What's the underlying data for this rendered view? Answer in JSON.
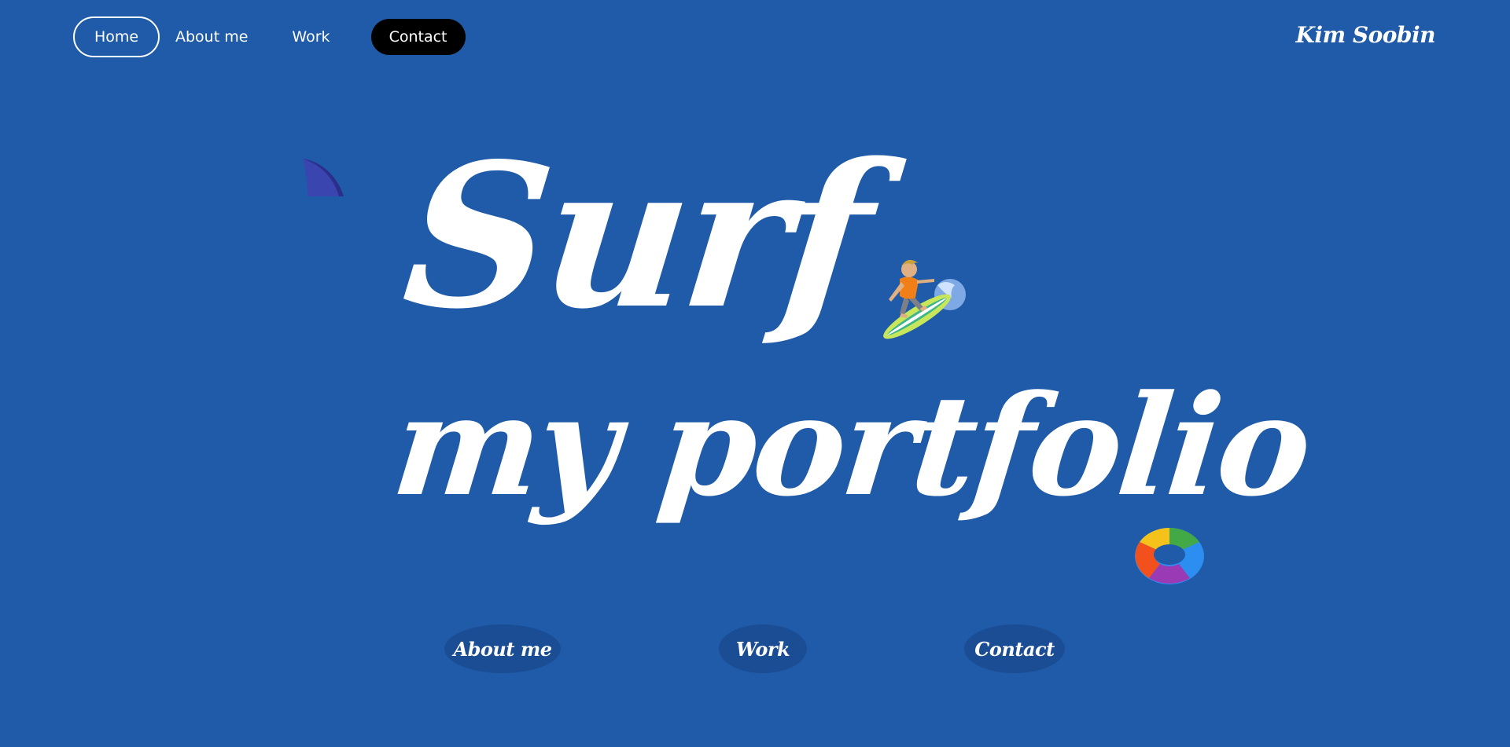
{
  "nav": {
    "items": [
      {
        "label": "Home"
      },
      {
        "label": "About me"
      },
      {
        "label": "Work"
      },
      {
        "label": "Contact"
      }
    ]
  },
  "brand": "Kim Soobin",
  "hero": {
    "line1": "Surf",
    "line2": "my portfolio"
  },
  "decorations": {
    "fin": "shark-fin-icon",
    "surfer": "surfer-icon",
    "ring": "swim-ring-icon"
  },
  "cta": {
    "about": "About me",
    "work": "Work",
    "contact": "Contact"
  },
  "colors": {
    "background": "#1f5ba8",
    "cta_background": "#1a4d93",
    "contact_nav": "#000000",
    "text": "#ffffff"
  }
}
